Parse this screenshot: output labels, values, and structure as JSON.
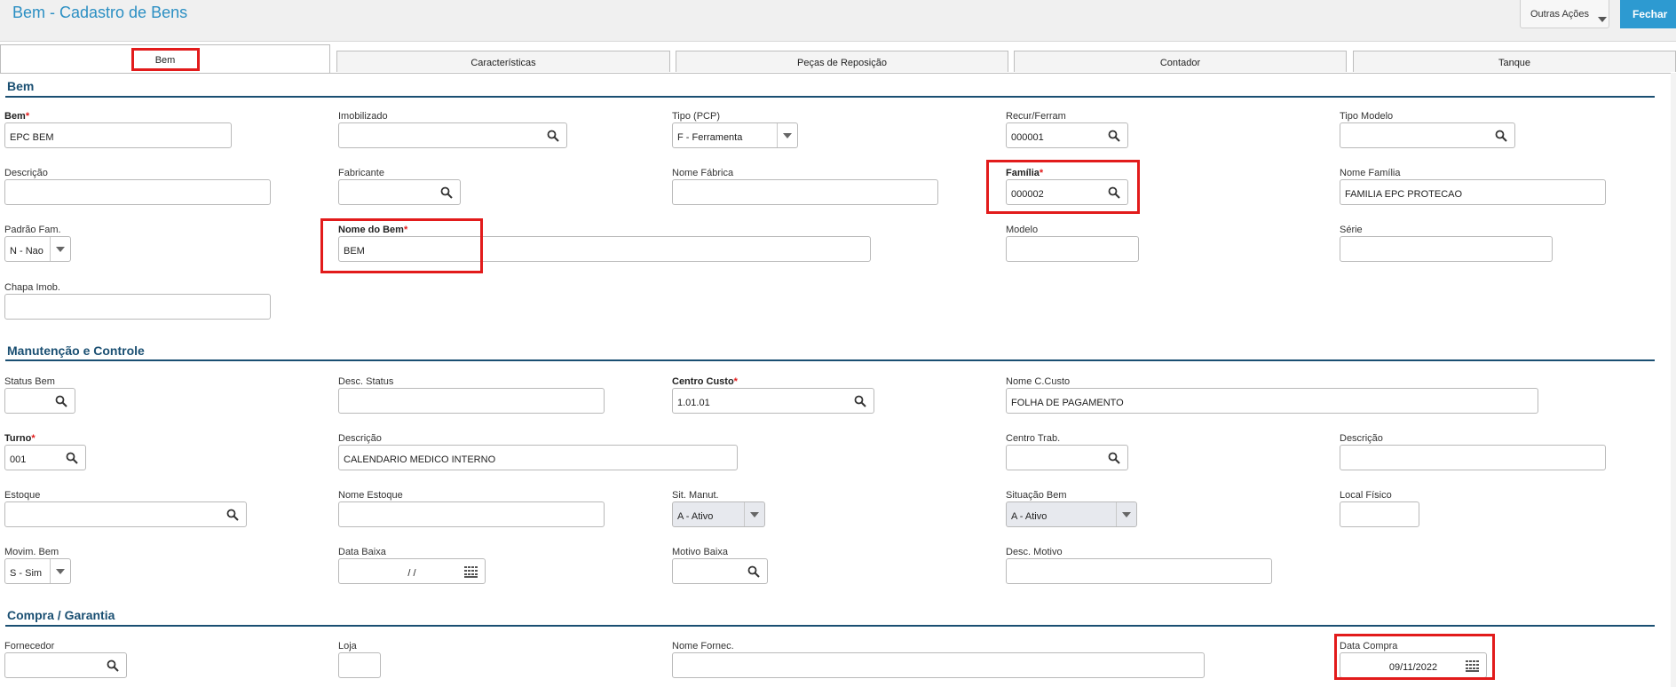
{
  "header": {
    "title": "Bem - Cadastro de Bens",
    "outras_acoes": "Outras Ações",
    "fechar": "Fechar"
  },
  "tabs": [
    {
      "label": "Bem"
    },
    {
      "label": "Características"
    },
    {
      "label": "Peças de Reposição"
    },
    {
      "label": "Contador"
    },
    {
      "label": "Tanque"
    }
  ],
  "sections": {
    "bem": "Bem",
    "manutencao": "Manutenção e Controle",
    "compra": "Compra / Garantia"
  },
  "fields": {
    "bem": {
      "label": "Bem",
      "value": "EPC BEM"
    },
    "imobilizado": {
      "label": "Imobilizado",
      "value": ""
    },
    "tipo_pcp": {
      "label": "Tipo (PCP)",
      "value": "F - Ferramenta"
    },
    "recur_ferram": {
      "label": "Recur/Ferram",
      "value": "000001"
    },
    "tipo_modelo": {
      "label": "Tipo Modelo",
      "value": ""
    },
    "descricao": {
      "label": "Descrição",
      "value": ""
    },
    "fabricante": {
      "label": "Fabricante",
      "value": ""
    },
    "nome_fabrica": {
      "label": "Nome Fábrica",
      "value": ""
    },
    "familia": {
      "label": "Família",
      "value": "000002"
    },
    "nome_familia": {
      "label": "Nome Família",
      "value": "FAMILIA EPC PROTECAO"
    },
    "padrao_fam": {
      "label": "Padrão Fam.",
      "value": "N - Nao"
    },
    "nome_bem": {
      "label": "Nome do Bem",
      "value": "BEM"
    },
    "modelo": {
      "label": "Modelo",
      "value": ""
    },
    "serie": {
      "label": "Série",
      "value": ""
    },
    "chapa_imob": {
      "label": "Chapa Imob.",
      "value": ""
    },
    "status_bem": {
      "label": "Status Bem",
      "value": ""
    },
    "desc_status": {
      "label": "Desc. Status",
      "value": ""
    },
    "centro_custo": {
      "label": "Centro Custo",
      "value": "1.01.01"
    },
    "nome_ccusto": {
      "label": "Nome C.Custo",
      "value": "FOLHA DE PAGAMENTO"
    },
    "turno": {
      "label": "Turno",
      "value": "001"
    },
    "descricao_turno": {
      "label": "Descrição",
      "value": "CALENDARIO MEDICO INTERNO"
    },
    "centro_trab": {
      "label": "Centro Trab.",
      "value": ""
    },
    "descricao_ct": {
      "label": "Descrição",
      "value": ""
    },
    "estoque": {
      "label": "Estoque",
      "value": ""
    },
    "nome_estoque": {
      "label": "Nome Estoque",
      "value": ""
    },
    "sit_manut": {
      "label": "Sit. Manut.",
      "value": "A - Ativo"
    },
    "situacao_bem": {
      "label": "Situação Bem",
      "value": "A - Ativo"
    },
    "local_fisico": {
      "label": "Local Físico",
      "value": ""
    },
    "movim_bem": {
      "label": "Movim. Bem",
      "value": "S - Sim"
    },
    "data_baixa": {
      "label": "Data Baixa",
      "value": "/ /"
    },
    "motivo_baixa": {
      "label": "Motivo Baixa",
      "value": ""
    },
    "desc_motivo": {
      "label": "Desc. Motivo",
      "value": ""
    },
    "fornecedor": {
      "label": "Fornecedor",
      "value": ""
    },
    "loja": {
      "label": "Loja",
      "value": ""
    },
    "nome_fornec": {
      "label": "Nome Fornec.",
      "value": ""
    },
    "data_compra": {
      "label": "Data Compra",
      "value": "09/11/2022"
    }
  },
  "required_marker": "*",
  "colors": {
    "accent": "#2d9ad1",
    "section": "#1a4f72",
    "highlight": "#e21b1b"
  }
}
